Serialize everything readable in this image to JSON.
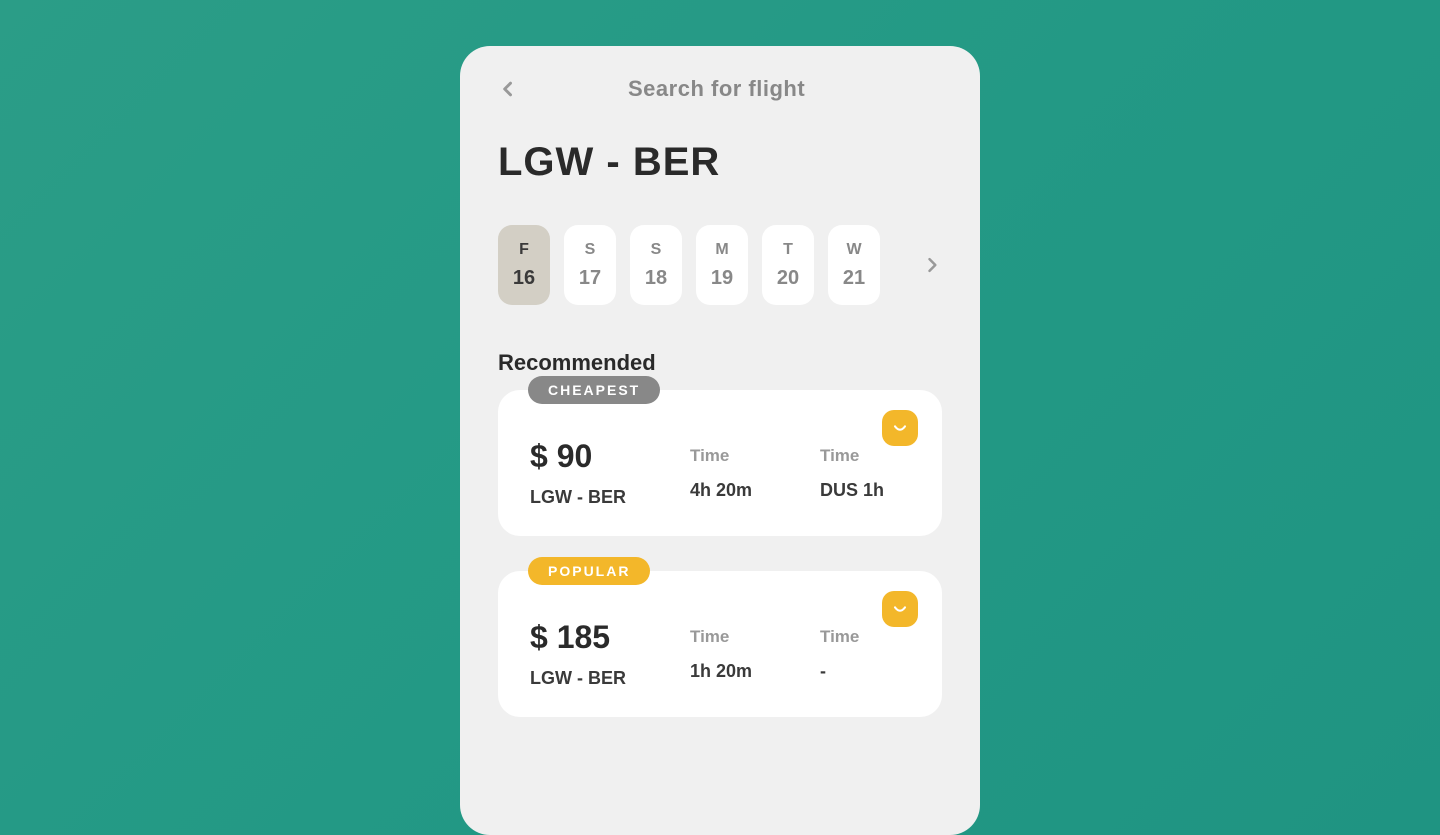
{
  "header": {
    "title": "Search for flight"
  },
  "route": "LGW - BER",
  "dates": [
    {
      "day": "F",
      "num": "16",
      "active": true
    },
    {
      "day": "S",
      "num": "17",
      "active": false
    },
    {
      "day": "S",
      "num": "18",
      "active": false
    },
    {
      "day": "M",
      "num": "19",
      "active": false
    },
    {
      "day": "T",
      "num": "20",
      "active": false
    },
    {
      "day": "W",
      "num": "21",
      "active": false
    }
  ],
  "section": {
    "title": "Recommended"
  },
  "flights": [
    {
      "badge": "CHEAPEST",
      "badgeType": "cheapest",
      "price": "$ 90",
      "route": "LGW - BER",
      "timeLabel1": "Time",
      "duration": "4h 20m",
      "timeLabel2": "Time",
      "layover": "DUS 1h"
    },
    {
      "badge": "POPULAR",
      "badgeType": "popular",
      "price": "$ 185",
      "route": "LGW - BER",
      "timeLabel1": "Time",
      "duration": "1h 20m",
      "timeLabel2": "Time",
      "layover": "-"
    }
  ]
}
